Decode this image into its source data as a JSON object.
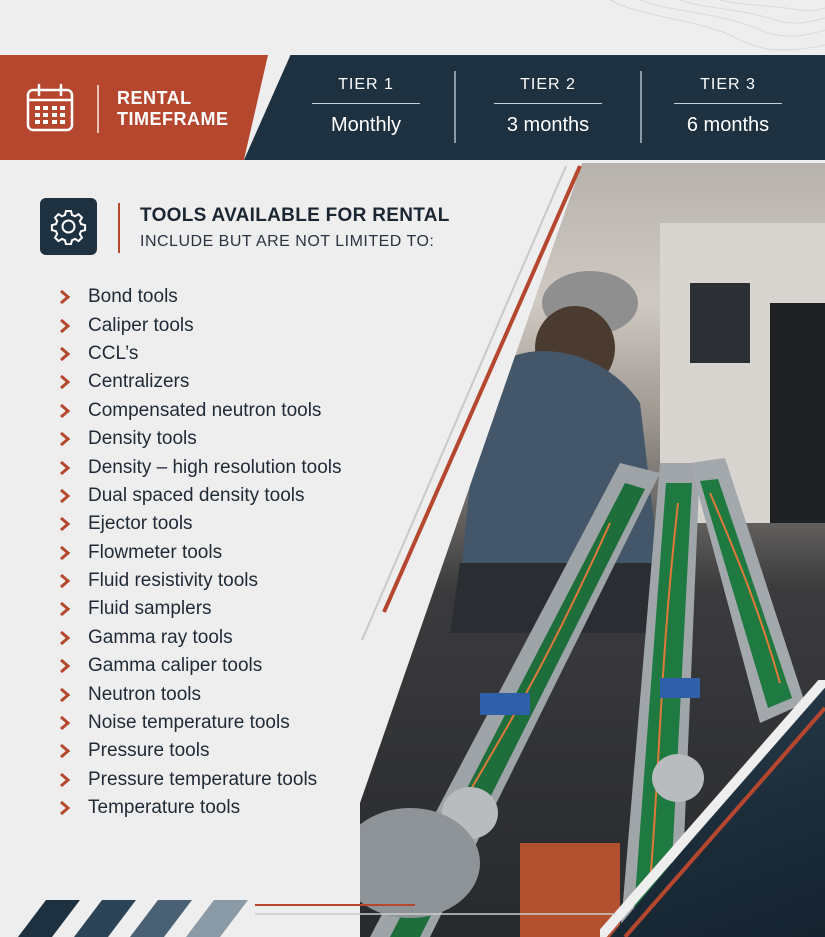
{
  "header": {
    "rental_label": "RENTAL\nTIMEFRAME",
    "tiers": [
      {
        "name": "TIER 1",
        "value": "Monthly"
      },
      {
        "name": "TIER 2",
        "value": "3 months"
      },
      {
        "name": "TIER 3",
        "value": "6 months"
      }
    ]
  },
  "tools": {
    "title": "TOOLS AVAILABLE FOR RENTAL",
    "subtitle": "INCLUDE BUT ARE NOT LIMITED TO:",
    "items": [
      "Bond tools",
      "Caliper tools",
      "CCL’s",
      "Centralizers",
      "Compensated neutron tools",
      "Density tools",
      "Density – high resolution tools",
      "Dual spaced density tools",
      "Ejector tools",
      "Flowmeter tools",
      "Fluid resistivity tools",
      "Fluid samplers",
      "Gamma ray tools",
      "Gamma caliper tools",
      "Neutron tools",
      "Noise temperature tools",
      "Pressure tools",
      "Pressure temperature tools",
      "Temperature tools"
    ]
  },
  "icons": {
    "header": "calendar-icon",
    "tools": "gear-icon",
    "bullet": "chevron-right-icon",
    "photo": "technician-workbench-photo"
  },
  "colors": {
    "accent": "#b6472f",
    "navy": "#1e3140",
    "background": "#eeeeee"
  }
}
